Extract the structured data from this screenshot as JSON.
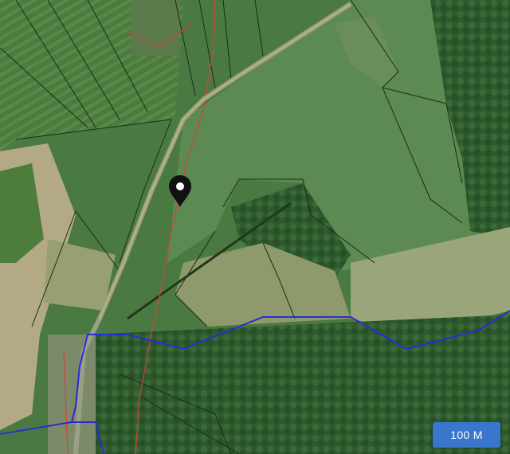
{
  "map": {
    "view": "satellite",
    "scale_label": "100 M",
    "marker_icon": "location-pin-icon"
  },
  "colors": {
    "road_blue": "#2b2bd6",
    "parcel_line": "#1c2b1a",
    "track_red": "#d0443a",
    "road_yellow": "#d6d24a",
    "scale_bg": "#3a77cc",
    "scale_text": "#ffffff"
  }
}
